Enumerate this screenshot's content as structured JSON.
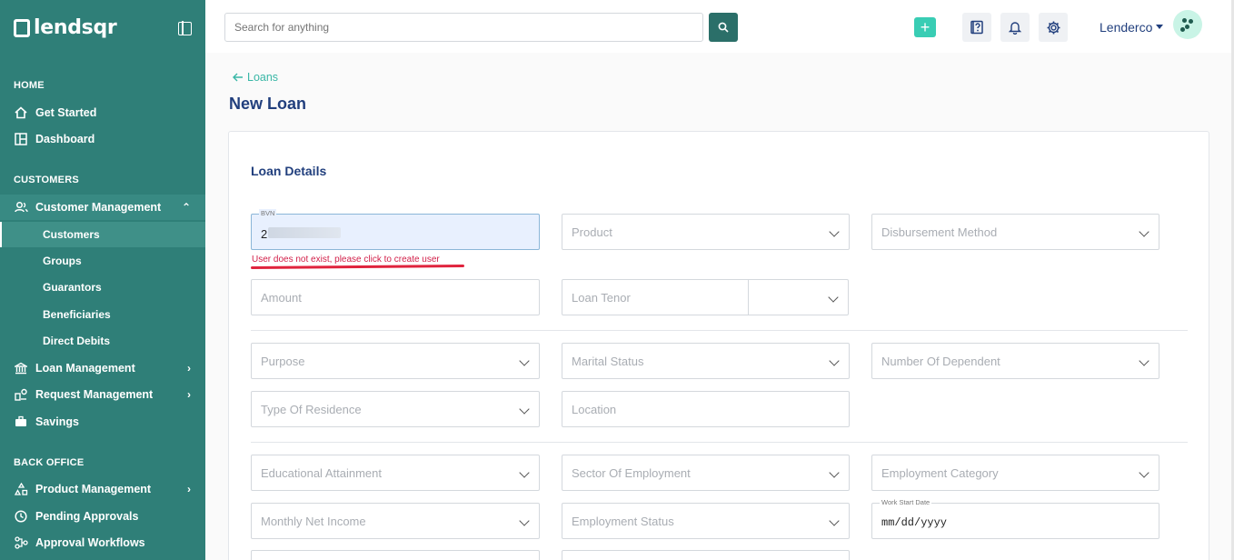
{
  "app": {
    "logo_text": "lendsqr"
  },
  "sidebar": {
    "sections": {
      "home": "HOME",
      "customers": "CUSTOMERS",
      "back_office": "BACK OFFICE"
    },
    "items": {
      "get_started": "Get Started",
      "dashboard": "Dashboard",
      "customer_management": "Customer Management",
      "customers": "Customers",
      "groups": "Groups",
      "guarantors": "Guarantors",
      "beneficiaries": "Beneficiaries",
      "direct_debits": "Direct Debits",
      "loan_management": "Loan Management",
      "request_management": "Request Management",
      "savings": "Savings",
      "product_management": "Product Management",
      "pending_approvals": "Pending Approvals",
      "approval_workflows": "Approval Workflows"
    }
  },
  "header": {
    "search_placeholder": "Search for anything",
    "user_name": "Lenderco",
    "plus_symbol": "+"
  },
  "page": {
    "breadcrumb": "Loans",
    "title": "New Loan",
    "section_title": "Loan Details"
  },
  "form": {
    "bvn_label": "BVN",
    "bvn_value": "2",
    "bvn_error": "User does not exist, please click to create user",
    "product": "Product",
    "disbursement_method": "Disbursement Method",
    "amount": "Amount",
    "loan_tenor": "Loan Tenor",
    "purpose": "Purpose",
    "marital_status": "Marital Status",
    "number_of_dependent": "Number Of Dependent",
    "type_of_residence": "Type Of Residence",
    "location": "Location",
    "educational_attainment": "Educational Attainment",
    "sector_of_employment": "Sector Of Employment",
    "employment_category": "Employment Category",
    "monthly_net_income": "Monthly Net Income",
    "employment_status": "Employment Status",
    "work_start_date_label": "Work Start Date",
    "work_start_date_value": "mm/dd/yyyy"
  },
  "colors": {
    "sidebar": "#2f7f78",
    "accent": "#39cdb4",
    "error": "#d2204a",
    "heading": "#213f7d"
  }
}
